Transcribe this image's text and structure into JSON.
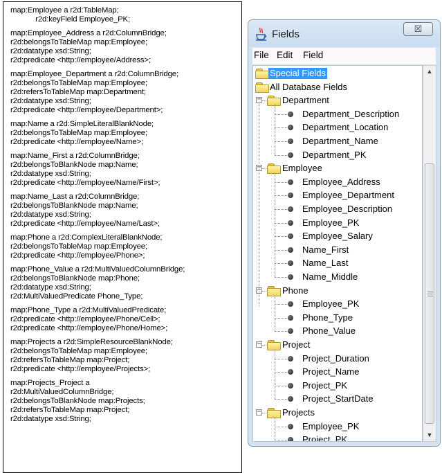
{
  "code": {
    "blocks": [
      [
        "map:Employee a r2d:TableMap;",
        "            r2d:keyField Employee_PK;"
      ],
      [
        "map:Employee_Address a r2d:ColumnBridge;",
        "r2d:belongsToTableMap map:Employee;",
        "r2d:datatype xsd:String;",
        "r2d:predicate <http://employee/Address>;"
      ],
      [
        "map:Employee_Department a r2d:ColumnBridge;",
        "r2d:belongsToTableMap map:Employee;",
        "r2d:refersToTableMap map:Department;",
        "r2d:datatype xsd:String;",
        "r2d:predicate <http://employee/Department>;"
      ],
      [
        "map:Name a r2d:SimpleLiteralBlankNode;",
        "r2d:belongsToTableMap map:Employee;",
        "r2d:predicate <http://employee/Name>;"
      ],
      [
        "map:Name_First a r2d:ColumnBridge;",
        "r2d:belongsToBlankNode map:Name;",
        "r2d:datatype xsd:String;",
        "r2d:predicate <http://employee/Name/First>;"
      ],
      [
        "map:Name_Last a r2d:ColumnBridge;",
        "r2d:belongsToBlankNode map:Name;",
        "r2d:datatype xsd:String;",
        "r2d:predicate <http://employee/Name/Last>;"
      ],
      [
        "map:Phone a r2d:ComplexLiteralBlankNode;",
        "r2d:belongsToTableMap map:Employee;",
        "r2d:predicate <http://employee/Phone>;"
      ],
      [
        "map:Phone_Value a r2d:MultiValuedColumnBridge;",
        "r2d:belongsToBlankNode map:Phone;",
        "r2d:datatype xsd:String;",
        "r2d:MultiValuedPredicate Phone_Type;"
      ],
      [
        "map:Phone_Type a r2d:MultiValuedPredicate;",
        "r2d:predicate <http://employee/Phone/Cell>;",
        "r2d:predicate <http://employee/Phone/Home>;"
      ],
      [
        "map:Projects a r2d:SimpleResourceBlankNode;",
        "r2d:belongsToTableMap map:Employee;",
        "r2d:refersToTableMap map:Project;",
        "r2d:predicate <http://employee/Projects>;"
      ],
      [
        "map:Projects_Project a",
        "r2d:MultiValuedColumnBridge;",
        "r2d:belongsToBlankNode map:Projects;",
        "r2d:refersToTableMap map:Project;",
        "r2d:datatype xsd:String;"
      ]
    ]
  },
  "window": {
    "title": "Fields",
    "close_glyph": "☒",
    "menu": [
      "File",
      "Edit",
      "Field"
    ],
    "scroll_up": "▲",
    "scroll_down": "▼"
  },
  "tree": {
    "roots": [
      {
        "label": "Special Fields",
        "selected": true
      },
      {
        "label": "All Database Fields"
      }
    ],
    "groups": [
      {
        "label": "Department",
        "fields": [
          "Department_Description",
          "Department_Location",
          "Department_Name",
          "Department_PK"
        ]
      },
      {
        "label": "Employee",
        "fields": [
          "Employee_Address",
          "Employee_Department",
          "Employee_Description",
          "Employee_PK",
          "Employee_Salary",
          "Name_First",
          "Name_Last",
          "Name_Middle"
        ]
      },
      {
        "label": "Phone",
        "fields": [
          "Employee_PK",
          "Phone_Type",
          "Phone_Value"
        ]
      },
      {
        "label": "Project",
        "fields": [
          "Project_Duration",
          "Project_Name",
          "Project_PK",
          "Project_StartDate"
        ]
      },
      {
        "label": "Projects",
        "fields": [
          "Employee_PK",
          "Project_PK"
        ]
      }
    ],
    "collapse_glyph": "−",
    "selection_color": "#3399ff"
  }
}
